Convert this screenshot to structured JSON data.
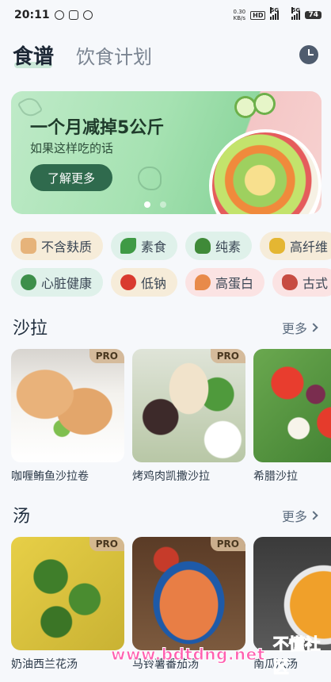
{
  "status_bar": {
    "time": "20:11",
    "net_speed_value": "0.30",
    "net_speed_unit": "KB/s",
    "hd_tag": "HD",
    "signal_1": "5G",
    "signal_2": "5G",
    "battery": "74"
  },
  "header": {
    "tab_active": "食谱",
    "tab_inactive": "饮食计划",
    "history_icon": "clock-icon"
  },
  "banner": {
    "title": "一个月减掉5公斤",
    "subtitle": "如果这样吃的话",
    "button_label": "了解更多",
    "dots": 2,
    "active_dot": 0
  },
  "filters": {
    "row1": [
      {
        "label": "不含麸质",
        "icon": "bread-icon",
        "color": "#e6b37a",
        "style": "c-beige"
      },
      {
        "label": "素食",
        "icon": "leaf-icon",
        "color": "#3f9a45",
        "style": "c-mint"
      },
      {
        "label": "纯素",
        "icon": "broccoli-icon",
        "color": "#3f8a38",
        "style": "c-mint"
      },
      {
        "label": "高纤维",
        "icon": "corn-icon",
        "color": "#e4b632",
        "style": "c-beige"
      }
    ],
    "row2": [
      {
        "label": "心脏健康",
        "icon": "salad-bowl-icon",
        "color": "#3d8f4a",
        "style": "c-mint"
      },
      {
        "label": "低钠",
        "icon": "apple-icon",
        "color": "#d93a2f",
        "style": "c-beige"
      },
      {
        "label": "高蛋白",
        "icon": "shrimp-icon",
        "color": "#e88a4a",
        "style": "c-pink"
      },
      {
        "label": "古式",
        "icon": "meat-icon",
        "color": "#c74c42",
        "style": "c-pink"
      }
    ]
  },
  "sections": {
    "salad": {
      "title": "沙拉",
      "more": "更多",
      "items": [
        {
          "title": "咖喱鲔鱼沙拉卷",
          "badge": "PRO"
        },
        {
          "title": "烤鸡肉凯撒沙拉",
          "badge": "PRO"
        },
        {
          "title": "希腊沙拉",
          "badge": ""
        }
      ]
    },
    "soup": {
      "title": "汤",
      "more": "更多",
      "items": [
        {
          "title": "奶油西兰花汤",
          "badge": "PRO"
        },
        {
          "title": "马铃薯番茄汤",
          "badge": "PRO"
        },
        {
          "title": "南瓜浓汤",
          "badge": ""
        }
      ]
    }
  },
  "watermark": {
    "url": "www.bdtdng.net",
    "logo": "不懂社区"
  }
}
